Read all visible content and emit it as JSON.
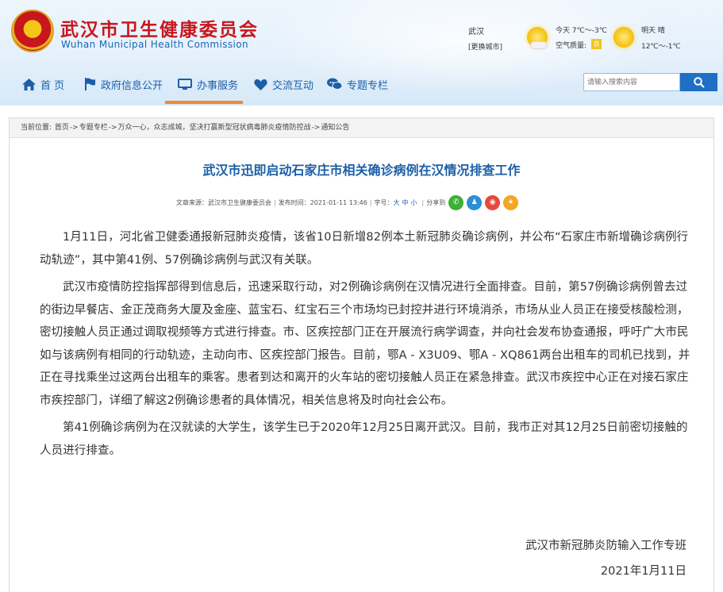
{
  "header": {
    "logo_cn": "武汉市卫生健康委员会",
    "logo_en": "Wuhan Municipal Health Commission",
    "weather": {
      "city": "武汉",
      "switch_city": "[更换城市]",
      "today_label": "今天",
      "today_temp": "7℃～-3℃",
      "air_quality_label": "空气质量:",
      "air_quality_value": "良",
      "tomorrow_label": "明天",
      "tomorrow_condition": "晴",
      "tomorrow_temp": "12℃～-1℃"
    }
  },
  "nav": {
    "items": [
      {
        "label": "首 页",
        "icon": "home-icon"
      },
      {
        "label": "政府信息公开",
        "icon": "flag-icon"
      },
      {
        "label": "办事服务",
        "icon": "monitor-icon"
      },
      {
        "label": "交流互动",
        "icon": "heart-icon"
      },
      {
        "label": "专题专栏",
        "icon": "chat-icon"
      }
    ],
    "active": "办事服务"
  },
  "search": {
    "placeholder": "请输入搜索内容",
    "icon": "search-icon"
  },
  "breadcrumb": {
    "label": "当前位置:",
    "items": [
      "首页",
      "专题专栏",
      "万众一心，众志成城，坚决打赢新型冠状病毒肺炎疫情防控战",
      "通知公告"
    ],
    "separator": "->"
  },
  "article": {
    "title": "武汉市迅即启动石家庄市相关确诊病例在汉情况排查工作",
    "meta": {
      "source_label": "文章来源：",
      "source": "武汉市卫生健康委员会",
      "published_label": "发布时间：",
      "published": "2021-01-11 13:46",
      "fontsize_label": "字号：",
      "font_large": "大",
      "font_medium": "中",
      "font_small": "小",
      "share_label": "分享到"
    },
    "paragraphs": [
      "1月11日，河北省卫健委通报新冠肺炎疫情，该省10日新增82例本土新冠肺炎确诊病例，并公布“石家庄市新增确诊病例行动轨迹”，其中第41例、57例确诊病例与武汉有关联。",
      "武汉市疫情防控指挥部得到信息后，迅速采取行动，对2例确诊病例在汉情况进行全面排查。目前，第57例确诊病例曾去过的街边早餐店、金正茂商务大厦及金座、蓝宝石、红宝石三个市场均已封控并进行环境消杀，市场从业人员正在接受核酸检测，密切接触人员正通过调取视频等方式进行排查。市、区疾控部门正在开展流行病学调查，并向社会发布协查通报，呼吁广大市民如与该病例有相同的行动轨迹，主动向市、区疾控部门报告。目前，鄂A - X3U09、鄂A - XQ861两台出租车的司机已找到，并正在寻找乘坐过这两台出租车的乘客。患者到达和离开的火车站的密切接触人员正在紧急排查。武汉市疾控中心正在对接石家庄市疾控部门，详细了解这2例确诊患者的具体情况，相关信息将及时向社会公布。",
      "第41例确诊病例为在汉就读的大学生，该学生已于2020年12月25日离开武汉。目前，我市正对其12月25日前密切接触的人员进行排查。"
    ],
    "signature": "武汉市新冠肺炎防输入工作专班",
    "date": "2021年1月11日"
  },
  "colors": {
    "brand_red": "#c8161d",
    "nav_blue": "#1b5fa8",
    "active_orange": "#f08a2a",
    "search_blue": "#1f6fc5"
  }
}
